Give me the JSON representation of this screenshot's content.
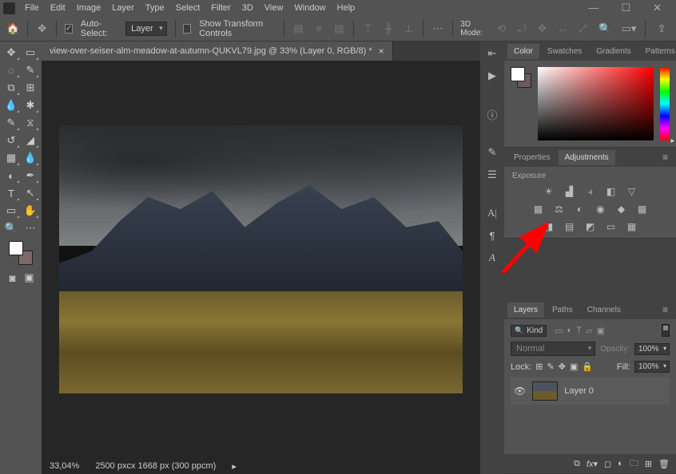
{
  "menu": {
    "items": [
      "File",
      "Edit",
      "Image",
      "Layer",
      "Type",
      "Select",
      "Filter",
      "3D",
      "View",
      "Window",
      "Help"
    ]
  },
  "win": {
    "min": "—",
    "max": "☐",
    "close": "✕"
  },
  "options": {
    "auto_select_label": "Auto-Select:",
    "auto_select_target": "Layer",
    "show_transform": "Show Transform Controls",
    "mode_label": "3D Mode:"
  },
  "doc": {
    "tab_title": "view-over-seiser-alm-meadow-at-autumn-QUKVL79.jpg @ 33% (Layer 0, RGB/8) *"
  },
  "status": {
    "zoom": "33,04%",
    "dims": "2500 pxcx 1668 px (300 ppcm)"
  },
  "panels": {
    "color": {
      "tabs": [
        "Color",
        "Swatches",
        "Gradients",
        "Patterns"
      ],
      "active": "Color"
    },
    "properties": {
      "tabs": [
        "Properties",
        "Adjustments"
      ],
      "active": "Adjustments",
      "hint": "Exposure"
    },
    "layers": {
      "tabs": [
        "Layers",
        "Paths",
        "Channels"
      ],
      "active": "Layers",
      "kind": "Kind",
      "blend": "Normal",
      "opacity_label": "Opacity:",
      "opacity": "100%",
      "lock_label": "Lock:",
      "fill_label": "Fill:",
      "fill": "100%",
      "layer0": "Layer 0"
    }
  }
}
